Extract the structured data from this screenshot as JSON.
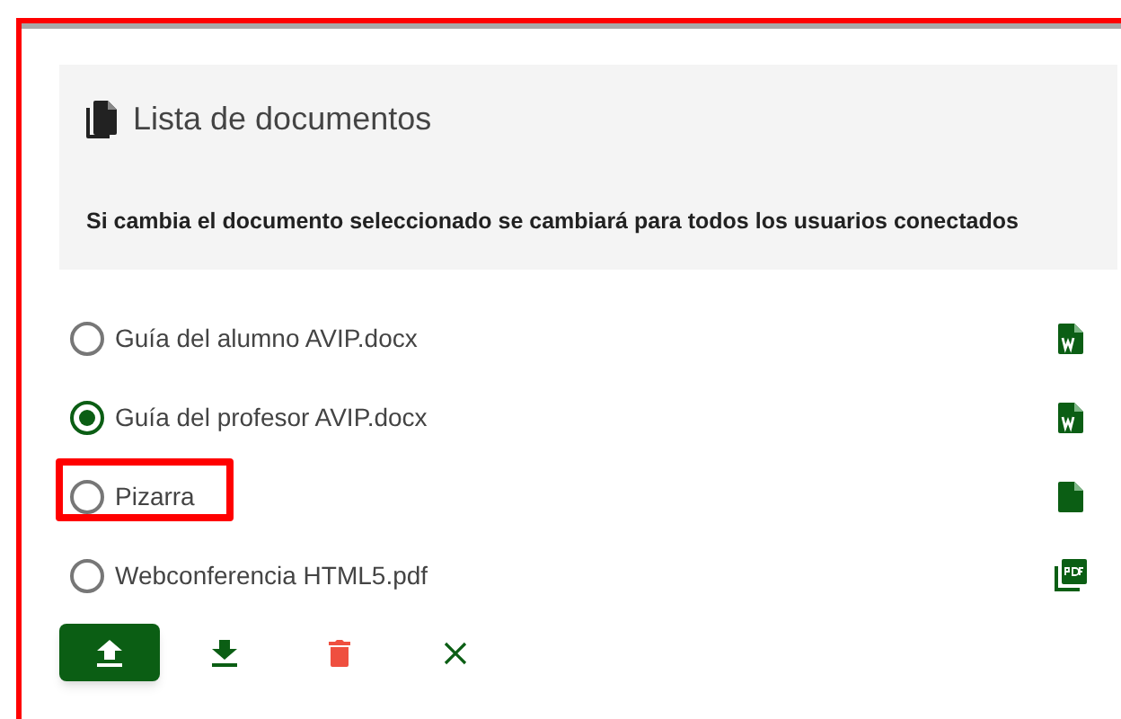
{
  "panel": {
    "title": "Lista de documentos",
    "notice": "Si cambia el documento seleccionado se cambiará para todos los usuarios conectados"
  },
  "documents": [
    {
      "name": "Guía del alumno AVIP.docx",
      "selected": false,
      "highlighted": false,
      "kind": "word"
    },
    {
      "name": "Guía del profesor AVIP.docx",
      "selected": true,
      "highlighted": false,
      "kind": "word"
    },
    {
      "name": "Pizarra",
      "selected": false,
      "highlighted": true,
      "kind": "file"
    },
    {
      "name": "Webconferencia HTML5.pdf",
      "selected": false,
      "highlighted": false,
      "kind": "pdf"
    }
  ],
  "actions": [
    {
      "kind": "upload"
    },
    {
      "kind": "download"
    },
    {
      "kind": "delete"
    },
    {
      "kind": "close"
    }
  ]
}
